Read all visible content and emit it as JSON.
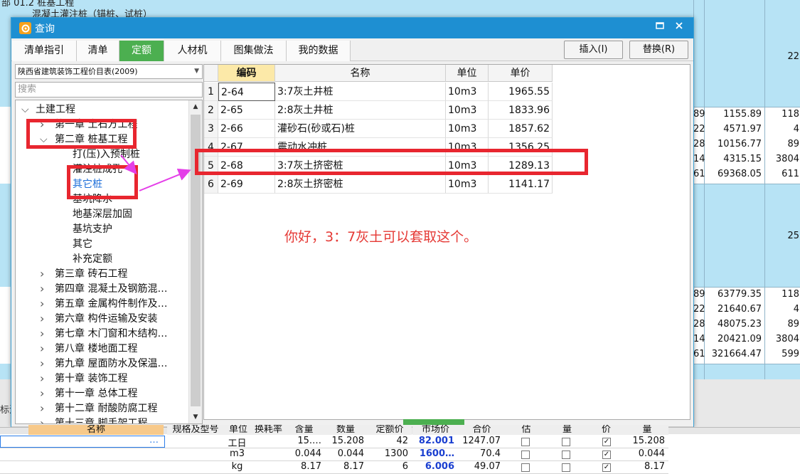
{
  "window": {
    "title": "查询",
    "buttons": [
      "插入(I)",
      "替换(R)"
    ]
  },
  "tabs": [
    "清单指引",
    "清单",
    "定额",
    "人材机",
    "图集做法",
    "我的数据"
  ],
  "active_tab": "定额",
  "left": {
    "library": "陕西省建筑装饰工程价目表(2009)",
    "search_placeholder": "搜索",
    "tree": [
      {
        "label": "土建工程",
        "expanded": true
      },
      {
        "label": "第一章  土石方工程"
      },
      {
        "label": "第二章  桩基工程",
        "expanded": true
      },
      {
        "label": "打(压)入预制桩"
      },
      {
        "label": "灌注桩成孔"
      },
      {
        "label": "其它桩",
        "selected": true
      },
      {
        "label": "基坑降水"
      },
      {
        "label": "地基深层加固"
      },
      {
        "label": "基坑支护"
      },
      {
        "label": "其它"
      },
      {
        "label": "补充定额"
      },
      {
        "label": "第三章  砖石工程"
      },
      {
        "label": "第四章  混凝土及钢筋混…"
      },
      {
        "label": "第五章  金属构件制作及…"
      },
      {
        "label": "第六章  构件运输及安装"
      },
      {
        "label": "第七章  木门窗和木结构…"
      },
      {
        "label": "第八章  楼地面工程"
      },
      {
        "label": "第九章  屋面防水及保温…"
      },
      {
        "label": "第十章  装饰工程"
      },
      {
        "label": "第十一章  总体工程"
      },
      {
        "label": "第十二章  耐酸防腐工程"
      },
      {
        "label": "第十三章  脚手架工程"
      }
    ]
  },
  "grid": {
    "headers": [
      "编码",
      "名称",
      "单位",
      "单价"
    ],
    "rows": [
      {
        "n": "1",
        "code": "2-64",
        "name": "3:7灰土井桩",
        "unit": "10m3",
        "price": "1965.55"
      },
      {
        "n": "2",
        "code": "2-65",
        "name": "2:8灰土井桩",
        "unit": "10m3",
        "price": "1833.96"
      },
      {
        "n": "3",
        "code": "2-66",
        "name": "灌砂石(砂或石)桩",
        "unit": "10m3",
        "price": "1857.62"
      },
      {
        "n": "4",
        "code": "2-67",
        "name": "震动水冲桩",
        "unit": "10m3",
        "price": "1356.25"
      },
      {
        "n": "5",
        "code": "2-68",
        "name": "3:7灰土挤密桩",
        "unit": "10m3",
        "price": "1289.13"
      },
      {
        "n": "6",
        "code": "2-69",
        "name": "2:8灰土挤密桩",
        "unit": "10m3",
        "price": "1141.17"
      }
    ]
  },
  "note": "你好，3：7灰土可以套取这个。",
  "background": {
    "top_text": "混凝土灌注桩（锚桩、试桩）",
    "top_text2": "部   01.2   桩基工程",
    "right_big1": "22",
    "right_big2": "25",
    "rows_a": [
      {
        "c1": "89",
        "c2": "1155.89",
        "c3": "118"
      },
      {
        "c1": "22",
        "c2": "4571.97",
        "c3": "4"
      },
      {
        "c1": "28",
        "c2": "10156.77",
        "c3": "89"
      },
      {
        "c1": "14",
        "c2": "4315.15",
        "c3": "3804"
      },
      {
        "c1": "61",
        "c2": "69368.05",
        "c3": "611"
      }
    ],
    "rows_b": [
      {
        "c1": "89",
        "c2": "63779.35",
        "c3": "118"
      },
      {
        "c1": "22",
        "c2": "21640.67",
        "c3": "4"
      },
      {
        "c1": "28",
        "c2": "48075.23",
        "c3": "89"
      },
      {
        "c1": "14",
        "c2": "20421.09",
        "c3": "3804"
      },
      {
        "c1": "61",
        "c2": "321664.47",
        "c3": "599"
      }
    ],
    "side_label": "标注",
    "bottom_headers": [
      "名称",
      "规格及型号",
      "单位",
      "换耗率",
      "含量",
      "数量",
      "定额价",
      "市场价",
      "合价",
      "估",
      "量",
      "价",
      "量"
    ],
    "bottom_rows": [
      {
        "unit": "工日",
        "qty1": "15.…",
        "qty2": "15.208",
        "p1": "42",
        "p2": "82.001",
        "total": "1247.07",
        "q": "15.208"
      },
      {
        "unit": "m3",
        "qty1": "0.044",
        "qty2": "0.044",
        "p1": "1300",
        "p2": "1600…",
        "total": "70.4",
        "q": "0.044"
      },
      {
        "unit": "kg",
        "qty1": "8.17",
        "qty2": "8.17",
        "p1": "6",
        "p2": "6.006",
        "total": "49.07",
        "q": "8.17"
      }
    ],
    "ellipsis": "…"
  }
}
